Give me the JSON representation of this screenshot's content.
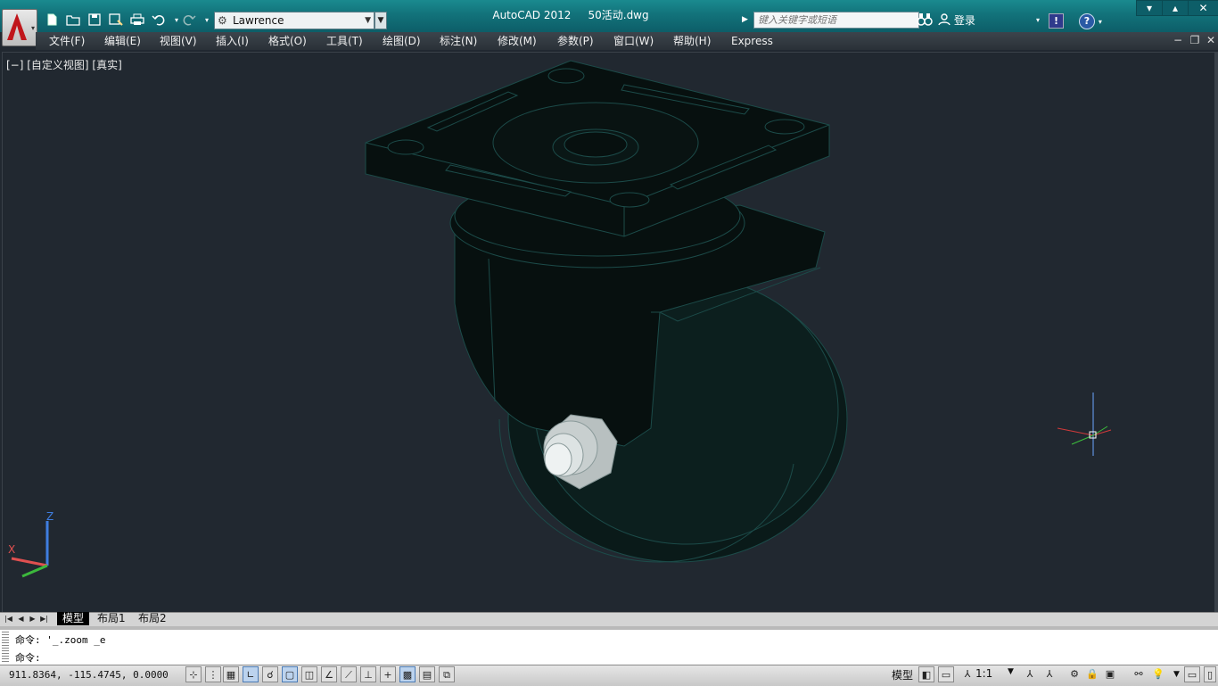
{
  "title_bar": {
    "app_name": "AutoCAD 2012",
    "document": "50活动.dwg",
    "workspace": "Lawrence",
    "search_placeholder": "键入关键字或短语",
    "login_label": "登录",
    "help_label": "?",
    "exchange_label": "!"
  },
  "quick_access": [
    {
      "name": "new-icon",
      "glyph": "🗋"
    },
    {
      "name": "open-icon",
      "glyph": "📂"
    },
    {
      "name": "save-icon",
      "glyph": "💾"
    },
    {
      "name": "saveas-icon",
      "glyph": "💾"
    },
    {
      "name": "print-icon",
      "glyph": "🖶"
    },
    {
      "name": "undo-icon",
      "glyph": "↶"
    },
    {
      "name": "redo-icon",
      "glyph": "↷"
    }
  ],
  "menu": [
    "文件(F)",
    "编辑(E)",
    "视图(V)",
    "插入(I)",
    "格式(O)",
    "工具(T)",
    "绘图(D)",
    "标注(N)",
    "修改(M)",
    "参数(P)",
    "窗口(W)",
    "帮助(H)",
    "Express"
  ],
  "viewport": {
    "label": "[−] [自定义视图] [真实]",
    "background": "#212830"
  },
  "ucs": {
    "x": "X",
    "y": "Y",
    "z": "Z"
  },
  "layout_tabs": [
    "模型",
    "布局1",
    "布局2"
  ],
  "command": {
    "history": "命令:  '_.zoom _e",
    "prompt": "命令:"
  },
  "status": {
    "coordinates": "911.8364, -115.4745, 0.0000",
    "model_label": "模型",
    "annotation_scale": "1:1"
  },
  "colors": {
    "titlebar": "#12727a",
    "accent_red": "#c0161b",
    "model_solid": "#07100f",
    "model_edge": "#1c4b49"
  }
}
